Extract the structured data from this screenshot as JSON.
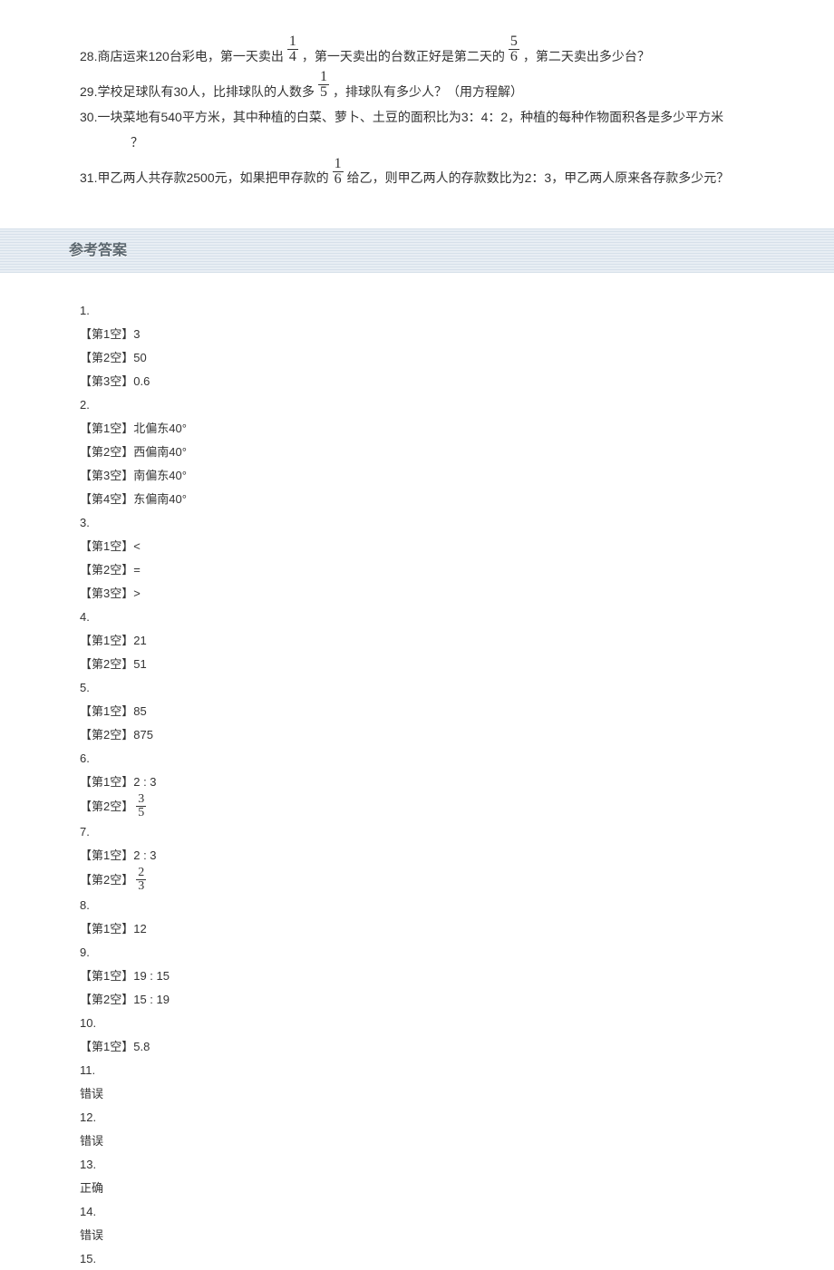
{
  "questions": {
    "q28": {
      "num": "28.",
      "t1": "商店运来120台彩电，第一天卖出",
      "f1n": "1",
      "f1d": "4",
      "t2": "，第一天卖出的台数正好是第二天的",
      "f2n": "5",
      "f2d": "6",
      "t3": "，第二天卖出多少台？"
    },
    "q29": {
      "num": "29.",
      "t1": "学校足球队有30人，比排球队的人数多",
      "f1n": "1",
      "f1d": "5",
      "t2": "，排球队有多少人？（用方程解）"
    },
    "q30": {
      "num": "30.",
      "t1": "一块菜地有540平方米，其中种植的白菜、萝卜、土豆的面积比为3：4：2，种植的每种作物面积各是多少平方米",
      "t2": "？"
    },
    "q31": {
      "num": "31.",
      "t1": "甲乙两人共存款2500元，如果把甲存款的",
      "f1n": "1",
      "f1d": "6",
      "t2": "给乙，则甲乙两人的存款数比为2：3，甲乙两人原来各存款多少元？"
    }
  },
  "section_title": "参考答案",
  "answers": [
    {
      "no": "1.",
      "blanks": [
        [
          "【第1空】",
          "3"
        ],
        [
          "【第2空】",
          "50"
        ],
        [
          "【第3空】",
          "0.6"
        ]
      ]
    },
    {
      "no": "2.",
      "blanks": [
        [
          "【第1空】",
          "北偏东40°"
        ],
        [
          "【第2空】",
          "西偏南40°"
        ],
        [
          "【第3空】",
          "南偏东40°"
        ],
        [
          "【第4空】",
          "东偏南40°"
        ]
      ]
    },
    {
      "no": "3.",
      "blanks": [
        [
          "【第1空】",
          "<"
        ],
        [
          "【第2空】",
          "="
        ],
        [
          "【第3空】",
          ">"
        ]
      ]
    },
    {
      "no": "4.",
      "blanks": [
        [
          "【第1空】",
          "21"
        ],
        [
          "【第2空】",
          "51"
        ]
      ]
    },
    {
      "no": "5.",
      "blanks": [
        [
          "【第1空】",
          "85"
        ],
        [
          "【第2空】",
          "875"
        ]
      ]
    },
    {
      "no": "6.",
      "blanks": [
        [
          "【第1空】",
          "2 : 3"
        ],
        [
          "【第2空】",
          "FRAC:3:5"
        ]
      ]
    },
    {
      "no": "7.",
      "blanks": [
        [
          "【第1空】",
          "2 : 3"
        ],
        [
          "【第2空】",
          "FRAC:2:3"
        ]
      ]
    },
    {
      "no": "8.",
      "blanks": [
        [
          "【第1空】",
          "12"
        ]
      ]
    },
    {
      "no": "9.",
      "blanks": [
        [
          "【第1空】",
          "19 : 15"
        ],
        [
          "【第2空】",
          "15 : 19"
        ]
      ]
    },
    {
      "no": "10.",
      "blanks": [
        [
          "【第1空】",
          "5.8"
        ]
      ]
    },
    {
      "no": "11.",
      "judge": "错误"
    },
    {
      "no": "12.",
      "judge": "错误"
    },
    {
      "no": "13.",
      "judge": "正确"
    },
    {
      "no": "14.",
      "judge": "错误"
    },
    {
      "no": "15."
    }
  ]
}
